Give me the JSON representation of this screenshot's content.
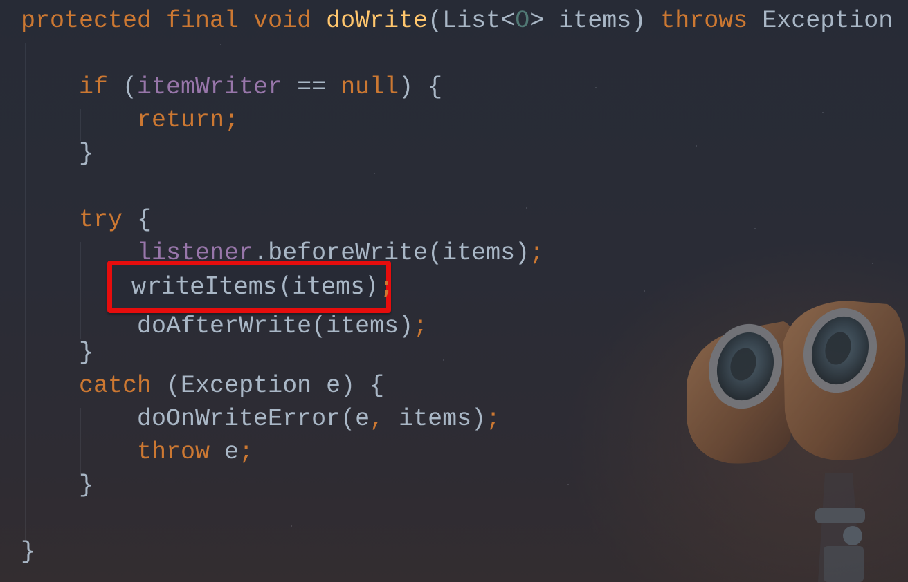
{
  "code": {
    "signature": {
      "kw_protected": "protected",
      "kw_final": "final",
      "kw_void": "void",
      "method_name": "doWrite",
      "open_type": "(List<",
      "type_param": "O",
      "close_params": "> items) ",
      "kw_throws": "throws",
      "exception_type": " Exception {"
    },
    "if_block": {
      "kw_if": "if",
      "cond_open": " (",
      "field": "itemWriter",
      "cond_rest": " == ",
      "kw_null": "null",
      "cond_close": ") {",
      "kw_return": "return",
      "semicolon": ";",
      "close": "}"
    },
    "try_block": {
      "kw_try": "try",
      "open": " {",
      "field_listener": "listener",
      "before_write_call": ".beforeWrite(items)",
      "semicolon": ";",
      "highlighted_call": "writeItems(items)",
      "highlighted_semicolon": ";",
      "after_write_call": "doAfterWrite(items)",
      "after_write_semicolon": ";",
      "close": "}"
    },
    "catch_block": {
      "kw_catch": "catch",
      "catch_params": " (Exception e) {",
      "error_call_start": "doOnWriteError(e",
      "comma": ",",
      "error_call_end": " items)",
      "semicolon": ";",
      "kw_throw": "throw",
      "throw_arg": " e",
      "throw_semicolon": ";",
      "close": "}"
    },
    "method_close": "}"
  },
  "colors": {
    "keyword": "#cc7832",
    "method_name": "#ffc66d",
    "field": "#9876aa",
    "type_param": "#507874",
    "text": "#a9b7c6",
    "highlight_border": "#e60d0d",
    "background": "#2a2c36"
  },
  "decorations": {
    "highlight": "red-highlight-box",
    "background_art": "robot-binocular-eyes-illustration"
  }
}
